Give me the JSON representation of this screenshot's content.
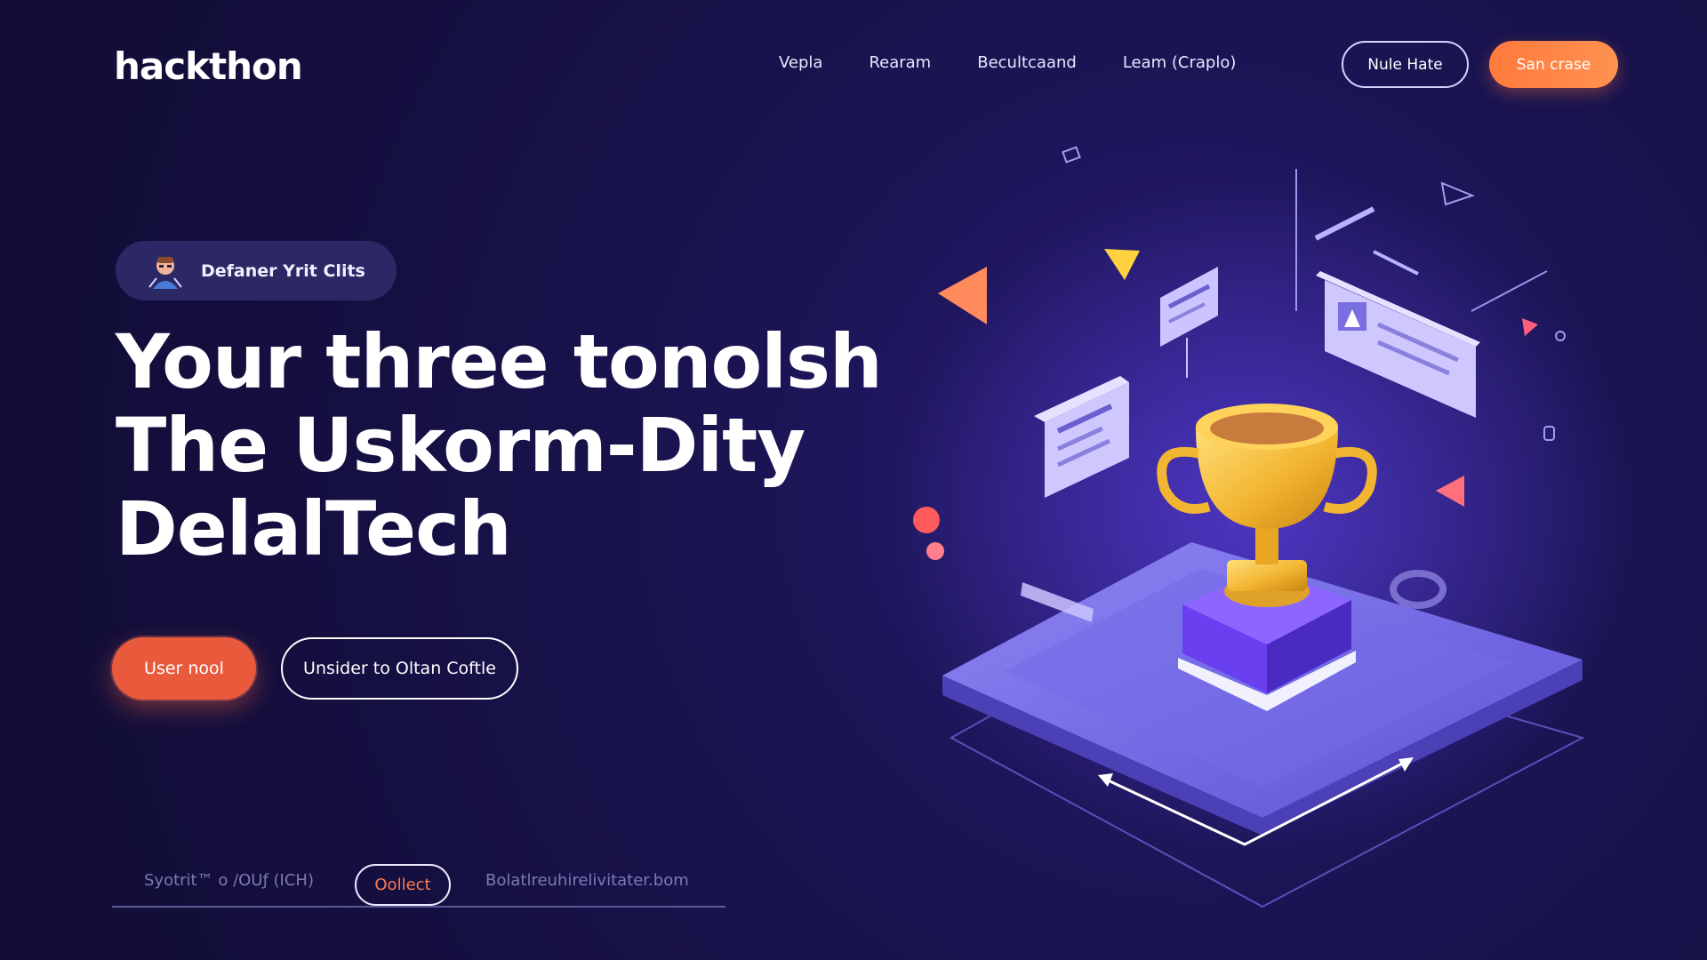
{
  "brand": {
    "logo_text": "hackthon"
  },
  "nav": {
    "links": [
      "Vepla",
      "Rearam",
      "Becultcaand",
      "Leam (Craplo)"
    ],
    "outline_button": "Nule Hate",
    "primary_button": "San crase"
  },
  "hero": {
    "badge_text": "Defaner Yrit Clits",
    "headline_lines": [
      "Your three tonolsh",
      "The Uskorm-Dity",
      "DelalTech"
    ],
    "cta_primary": "User nool",
    "cta_secondary": "Unsider to Oltan Coftle"
  },
  "footer": {
    "left_text": "Syotrit™ o /OUƒ (ICH)",
    "chip_label": "Oollect",
    "right_text": "Bolatlreuhirelivitater.bom"
  },
  "colors": {
    "background": "#140f3f",
    "accent_orange": "#ff7a3d",
    "accent_red": "#e95a3d",
    "platform_purple": "#6e63e0",
    "trophy_gold": "#f2b531"
  },
  "icons": {
    "badge_avatar": "developer-avatar-icon",
    "hero_art": "trophy-illustration"
  }
}
